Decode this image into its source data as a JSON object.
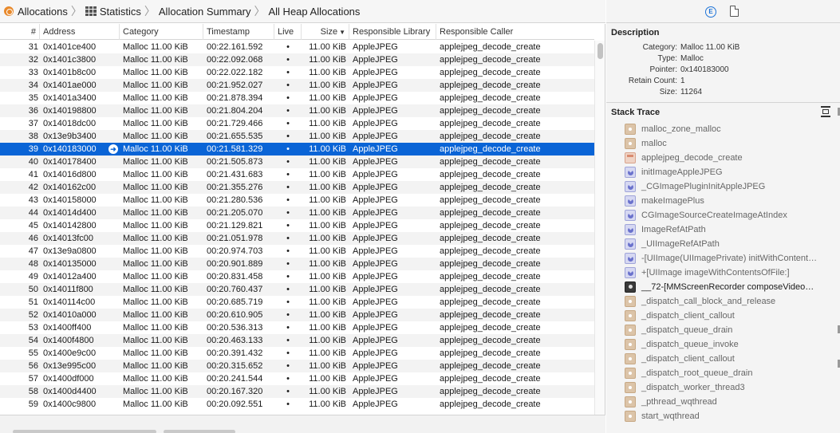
{
  "breadcrumb": {
    "items": [
      "Allocations",
      "Statistics",
      "Allocation Summary",
      "All Heap Allocations"
    ]
  },
  "table": {
    "headers": {
      "num": "#",
      "address": "Address",
      "category": "Category",
      "timestamp": "Timestamp",
      "live": "Live",
      "size": "Size",
      "library": "Responsible Library",
      "caller": "Responsible Caller"
    },
    "selected_index": 8,
    "rows": [
      {
        "num": "31",
        "address": "0x1401ce400",
        "category": "Malloc 11.00 KiB",
        "timestamp": "00:22.161.592",
        "live": "•",
        "size": "11.00 KiB",
        "library": "AppleJPEG",
        "caller": "applejpeg_decode_create"
      },
      {
        "num": "32",
        "address": "0x1401c3800",
        "category": "Malloc 11.00 KiB",
        "timestamp": "00:22.092.068",
        "live": "•",
        "size": "11.00 KiB",
        "library": "AppleJPEG",
        "caller": "applejpeg_decode_create"
      },
      {
        "num": "33",
        "address": "0x1401b8c00",
        "category": "Malloc 11.00 KiB",
        "timestamp": "00:22.022.182",
        "live": "•",
        "size": "11.00 KiB",
        "library": "AppleJPEG",
        "caller": "applejpeg_decode_create"
      },
      {
        "num": "34",
        "address": "0x1401ae000",
        "category": "Malloc 11.00 KiB",
        "timestamp": "00:21.952.027",
        "live": "•",
        "size": "11.00 KiB",
        "library": "AppleJPEG",
        "caller": "applejpeg_decode_create"
      },
      {
        "num": "35",
        "address": "0x1401a3400",
        "category": "Malloc 11.00 KiB",
        "timestamp": "00:21.878.394",
        "live": "•",
        "size": "11.00 KiB",
        "library": "AppleJPEG",
        "caller": "applejpeg_decode_create"
      },
      {
        "num": "36",
        "address": "0x140198800",
        "category": "Malloc 11.00 KiB",
        "timestamp": "00:21.804.204",
        "live": "•",
        "size": "11.00 KiB",
        "library": "AppleJPEG",
        "caller": "applejpeg_decode_create"
      },
      {
        "num": "37",
        "address": "0x14018dc00",
        "category": "Malloc 11.00 KiB",
        "timestamp": "00:21.729.466",
        "live": "•",
        "size": "11.00 KiB",
        "library": "AppleJPEG",
        "caller": "applejpeg_decode_create"
      },
      {
        "num": "38",
        "address": "0x13e9b3400",
        "category": "Malloc 11.00 KiB",
        "timestamp": "00:21.655.535",
        "live": "•",
        "size": "11.00 KiB",
        "library": "AppleJPEG",
        "caller": "applejpeg_decode_create"
      },
      {
        "num": "39",
        "address": "0x140183000",
        "category": "Malloc 11.00 KiB",
        "timestamp": "00:21.581.329",
        "live": "•",
        "size": "11.00 KiB",
        "library": "AppleJPEG",
        "caller": "applejpeg_decode_create"
      },
      {
        "num": "40",
        "address": "0x140178400",
        "category": "Malloc 11.00 KiB",
        "timestamp": "00:21.505.873",
        "live": "•",
        "size": "11.00 KiB",
        "library": "AppleJPEG",
        "caller": "applejpeg_decode_create"
      },
      {
        "num": "41",
        "address": "0x14016d800",
        "category": "Malloc 11.00 KiB",
        "timestamp": "00:21.431.683",
        "live": "•",
        "size": "11.00 KiB",
        "library": "AppleJPEG",
        "caller": "applejpeg_decode_create"
      },
      {
        "num": "42",
        "address": "0x140162c00",
        "category": "Malloc 11.00 KiB",
        "timestamp": "00:21.355.276",
        "live": "•",
        "size": "11.00 KiB",
        "library": "AppleJPEG",
        "caller": "applejpeg_decode_create"
      },
      {
        "num": "43",
        "address": "0x140158000",
        "category": "Malloc 11.00 KiB",
        "timestamp": "00:21.280.536",
        "live": "•",
        "size": "11.00 KiB",
        "library": "AppleJPEG",
        "caller": "applejpeg_decode_create"
      },
      {
        "num": "44",
        "address": "0x14014d400",
        "category": "Malloc 11.00 KiB",
        "timestamp": "00:21.205.070",
        "live": "•",
        "size": "11.00 KiB",
        "library": "AppleJPEG",
        "caller": "applejpeg_decode_create"
      },
      {
        "num": "45",
        "address": "0x140142800",
        "category": "Malloc 11.00 KiB",
        "timestamp": "00:21.129.821",
        "live": "•",
        "size": "11.00 KiB",
        "library": "AppleJPEG",
        "caller": "applejpeg_decode_create"
      },
      {
        "num": "46",
        "address": "0x14013fc00",
        "category": "Malloc 11.00 KiB",
        "timestamp": "00:21.051.978",
        "live": "•",
        "size": "11.00 KiB",
        "library": "AppleJPEG",
        "caller": "applejpeg_decode_create"
      },
      {
        "num": "47",
        "address": "0x13e9a0800",
        "category": "Malloc 11.00 KiB",
        "timestamp": "00:20.974.703",
        "live": "•",
        "size": "11.00 KiB",
        "library": "AppleJPEG",
        "caller": "applejpeg_decode_create"
      },
      {
        "num": "48",
        "address": "0x140135000",
        "category": "Malloc 11.00 KiB",
        "timestamp": "00:20.901.889",
        "live": "•",
        "size": "11.00 KiB",
        "library": "AppleJPEG",
        "caller": "applejpeg_decode_create"
      },
      {
        "num": "49",
        "address": "0x14012a400",
        "category": "Malloc 11.00 KiB",
        "timestamp": "00:20.831.458",
        "live": "•",
        "size": "11.00 KiB",
        "library": "AppleJPEG",
        "caller": "applejpeg_decode_create"
      },
      {
        "num": "50",
        "address": "0x14011f800",
        "category": "Malloc 11.00 KiB",
        "timestamp": "00:20.760.437",
        "live": "•",
        "size": "11.00 KiB",
        "library": "AppleJPEG",
        "caller": "applejpeg_decode_create"
      },
      {
        "num": "51",
        "address": "0x140114c00",
        "category": "Malloc 11.00 KiB",
        "timestamp": "00:20.685.719",
        "live": "•",
        "size": "11.00 KiB",
        "library": "AppleJPEG",
        "caller": "applejpeg_decode_create"
      },
      {
        "num": "52",
        "address": "0x14010a000",
        "category": "Malloc 11.00 KiB",
        "timestamp": "00:20.610.905",
        "live": "•",
        "size": "11.00 KiB",
        "library": "AppleJPEG",
        "caller": "applejpeg_decode_create"
      },
      {
        "num": "53",
        "address": "0x1400ff400",
        "category": "Malloc 11.00 KiB",
        "timestamp": "00:20.536.313",
        "live": "•",
        "size": "11.00 KiB",
        "library": "AppleJPEG",
        "caller": "applejpeg_decode_create"
      },
      {
        "num": "54",
        "address": "0x1400f4800",
        "category": "Malloc 11.00 KiB",
        "timestamp": "00:20.463.133",
        "live": "•",
        "size": "11.00 KiB",
        "library": "AppleJPEG",
        "caller": "applejpeg_decode_create"
      },
      {
        "num": "55",
        "address": "0x1400e9c00",
        "category": "Malloc 11.00 KiB",
        "timestamp": "00:20.391.432",
        "live": "•",
        "size": "11.00 KiB",
        "library": "AppleJPEG",
        "caller": "applejpeg_decode_create"
      },
      {
        "num": "56",
        "address": "0x13e995c00",
        "category": "Malloc 11.00 KiB",
        "timestamp": "00:20.315.652",
        "live": "•",
        "size": "11.00 KiB",
        "library": "AppleJPEG",
        "caller": "applejpeg_decode_create"
      },
      {
        "num": "57",
        "address": "0x1400df000",
        "category": "Malloc 11.00 KiB",
        "timestamp": "00:20.241.544",
        "live": "•",
        "size": "11.00 KiB",
        "library": "AppleJPEG",
        "caller": "applejpeg_decode_create"
      },
      {
        "num": "58",
        "address": "0x1400d4400",
        "category": "Malloc 11.00 KiB",
        "timestamp": "00:20.167.320",
        "live": "•",
        "size": "11.00 KiB",
        "library": "AppleJPEG",
        "caller": "applejpeg_decode_create"
      },
      {
        "num": "59",
        "address": "0x1400c9800",
        "category": "Malloc 11.00 KiB",
        "timestamp": "00:20.092.551",
        "live": "•",
        "size": "11.00 KiB",
        "library": "AppleJPEG",
        "caller": "applejpeg_decode_create"
      }
    ]
  },
  "inspector": {
    "description_title": "Description",
    "description": [
      {
        "key": "Category:",
        "value": "Malloc 11.00 KiB"
      },
      {
        "key": "Type:",
        "value": "Malloc"
      },
      {
        "key": "Pointer:",
        "value": "0x140183000"
      },
      {
        "key": "Retain Count:",
        "value": "1"
      },
      {
        "key": "Size:",
        "value": "11264"
      }
    ],
    "stack_title": "Stack Trace",
    "frames": [
      {
        "label": "malloc_zone_malloc",
        "icon": "sys"
      },
      {
        "label": "malloc",
        "icon": "sys"
      },
      {
        "label": "applejpeg_decode_create",
        "icon": "lib"
      },
      {
        "label": "initImageAppleJPEG",
        "icon": "uikit"
      },
      {
        "label": "_CGImagePluginInitAppleJPEG",
        "icon": "uikit"
      },
      {
        "label": "makeImagePlus",
        "icon": "uikit"
      },
      {
        "label": "CGImageSourceCreateImageAtIndex",
        "icon": "uikit"
      },
      {
        "label": "ImageRefAtPath",
        "icon": "uikit"
      },
      {
        "label": "_UIImageRefAtPath",
        "icon": "uikit"
      },
      {
        "label": "-[UIImage(UIImagePrivate) initWithContent…",
        "icon": "uikit"
      },
      {
        "label": "+[UIImage imageWithContentsOfFile:]",
        "icon": "uikit"
      },
      {
        "label": "__72-[MMScreenRecorder composeVideo…",
        "icon": "dark"
      },
      {
        "label": "_dispatch_call_block_and_release",
        "icon": "sys"
      },
      {
        "label": "_dispatch_client_callout",
        "icon": "sys"
      },
      {
        "label": "_dispatch_queue_drain",
        "icon": "sys"
      },
      {
        "label": "_dispatch_queue_invoke",
        "icon": "sys"
      },
      {
        "label": "_dispatch_client_callout",
        "icon": "sys"
      },
      {
        "label": "_dispatch_root_queue_drain",
        "icon": "sys"
      },
      {
        "label": "_dispatch_worker_thread3",
        "icon": "sys"
      },
      {
        "label": "_pthread_wqthread",
        "icon": "sys"
      },
      {
        "label": "start_wqthread",
        "icon": "sys"
      }
    ]
  }
}
